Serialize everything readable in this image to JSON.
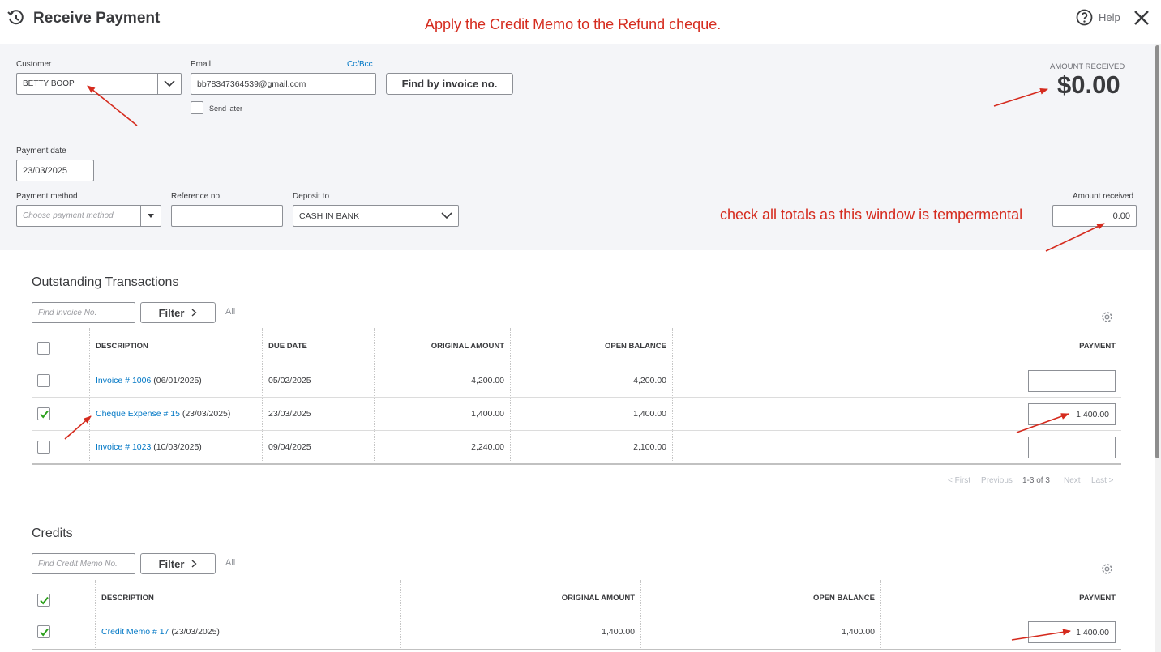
{
  "header": {
    "title": "Receive Payment",
    "help_label": "Help",
    "annotation_top": "Apply the Credit Memo to the Refund cheque."
  },
  "form": {
    "customer_label": "Customer",
    "customer_value": "BETTY BOOP",
    "email_label": "Email",
    "cc_bcc_label": "Cc/Bcc",
    "email_value": "bb78347364539@gmail.com",
    "send_later_label": "Send later",
    "find_invoice_button": "Find by invoice no.",
    "amount_received_heading": "AMOUNT RECEIVED",
    "amount_received_big": "$0.00",
    "payment_date_label": "Payment date",
    "payment_date_value": "23/03/2025",
    "payment_method_label": "Payment method",
    "payment_method_placeholder": "Choose payment method",
    "reference_label": "Reference no.",
    "reference_value": "",
    "deposit_label": "Deposit to",
    "deposit_value": "CASH IN BANK",
    "amount_received_label": "Amount received",
    "amount_received_value": "0.00",
    "annotation_totals": "check all totals as this window is tempermental"
  },
  "outstanding": {
    "title": "Outstanding Transactions",
    "search_placeholder": "Find Invoice No.",
    "filter_label": "Filter",
    "all_label": "All",
    "columns": {
      "description": "DESCRIPTION",
      "due_date": "DUE DATE",
      "original_amount": "ORIGINAL AMOUNT",
      "open_balance": "OPEN BALANCE",
      "payment": "PAYMENT"
    },
    "rows": [
      {
        "link": "Invoice # 1006",
        "date": "(06/01/2025)",
        "due": "05/02/2025",
        "original": "4,200.00",
        "open": "4,200.00",
        "payment": "",
        "checked": false
      },
      {
        "link": "Cheque Expense # 15",
        "date": "(23/03/2025)",
        "due": "23/03/2025",
        "original": "1,400.00",
        "open": "1,400.00",
        "payment": "1,400.00",
        "checked": true
      },
      {
        "link": "Invoice # 1023",
        "date": "(10/03/2025)",
        "due": "09/04/2025",
        "original": "2,240.00",
        "open": "2,100.00",
        "payment": "",
        "checked": false
      }
    ],
    "pager": {
      "first": "< First",
      "previous": "Previous",
      "range": "1-3 of 3",
      "next": "Next",
      "last": "Last >"
    }
  },
  "credits": {
    "title": "Credits",
    "search_placeholder": "Find Credit Memo No.",
    "filter_label": "Filter",
    "all_label": "All",
    "columns": {
      "description": "DESCRIPTION",
      "original_amount": "ORIGINAL AMOUNT",
      "open_balance": "OPEN BALANCE",
      "payment": "PAYMENT"
    },
    "rows": [
      {
        "link": "Credit Memo # 17",
        "date": "(23/03/2025)",
        "original": "1,400.00",
        "open": "1,400.00",
        "payment": "1,400.00",
        "checked": true
      }
    ]
  },
  "colors": {
    "annotation": "#d52b1e",
    "link": "#0077c5",
    "check_green": "#2ca01c",
    "panel_bg": "#f4f5f8"
  }
}
